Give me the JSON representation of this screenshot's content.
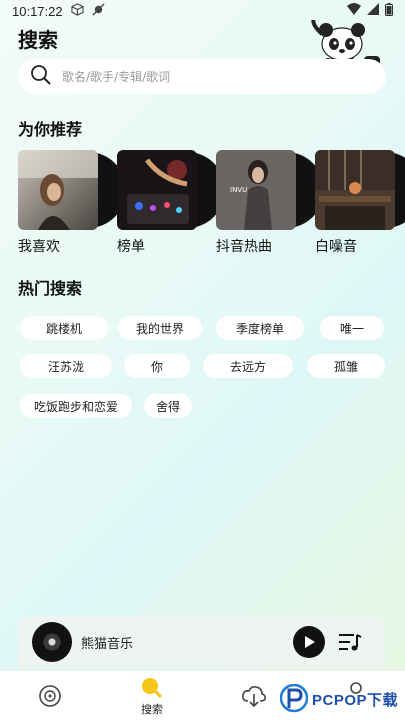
{
  "status_bar": {
    "time": "10:17:22"
  },
  "header": {
    "title": "搜索"
  },
  "search": {
    "placeholder": "歌名/歌手/专辑/歌词"
  },
  "recommend": {
    "title": "为你推荐",
    "items": [
      {
        "label": "我喜欢"
      },
      {
        "label": "榜单"
      },
      {
        "label": "抖音热曲",
        "art_text": "INVU"
      },
      {
        "label": "白噪音"
      }
    ]
  },
  "hot": {
    "title": "热门搜索",
    "tags": [
      "跳楼机",
      "我的世界",
      "季度榜单",
      "唯一",
      "汪苏泷",
      "你",
      "去远方",
      "孤雏",
      "吃饭跑步和恋爱",
      "舍得"
    ]
  },
  "player": {
    "title": "熊猫音乐"
  },
  "tabbar": {
    "items": [
      {
        "label": ""
      },
      {
        "label": "搜索"
      },
      {
        "label": ""
      },
      {
        "label": ""
      }
    ]
  },
  "watermark": {
    "text": "PCPOP下载"
  },
  "colors": {
    "accent_yellow": "#f5c518",
    "tag_bg": "#ffffff",
    "watermark_blue": "#1f4fa8"
  }
}
